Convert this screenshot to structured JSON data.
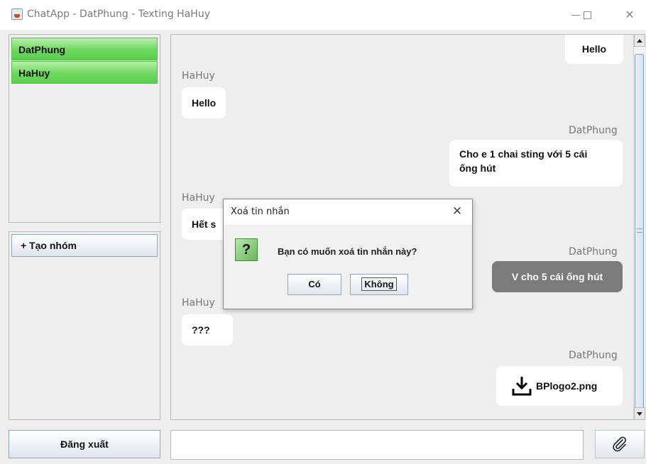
{
  "window": {
    "title": "ChatApp - DatPhung - Texting HaHuy",
    "minimize_icon": "minimize-icon",
    "maximize_icon": "maximize-icon",
    "close_icon": "close-icon"
  },
  "contacts": [
    {
      "name": "DatPhung"
    },
    {
      "name": "HaHuy"
    }
  ],
  "group": {
    "create_label": "+ Tạo nhóm"
  },
  "messages": [
    {
      "sender": "",
      "text": "Hello",
      "side": "right"
    },
    {
      "sender": "HaHuy",
      "text": "Hello",
      "side": "left"
    },
    {
      "sender": "DatPhung",
      "text_line1": "Cho e 1 chai sting với 5 cái",
      "text_line2": "ống hút",
      "side": "right"
    },
    {
      "sender": "HaHuy",
      "text": "Hết s",
      "side": "left"
    },
    {
      "sender": "DatPhung",
      "text": "V cho 5 cái ống hút",
      "side": "right",
      "selected": true
    },
    {
      "sender": "HaHuy",
      "text": "???",
      "side": "left"
    },
    {
      "sender": "DatPhung",
      "file": "BPlogo2.png",
      "icon": "download-icon",
      "side": "right"
    }
  ],
  "bottom": {
    "logout_label": "Đăng xuất",
    "message_value": "",
    "attach_icon": "paperclip-icon"
  },
  "dialog": {
    "title": "Xoá tin nhắn",
    "message": "Bạn có muốn xoá tin nhắn này?",
    "icon": "question-icon",
    "yes_label": "Có",
    "no_label": "Không"
  },
  "colors": {
    "contact_green": "#6ed860",
    "selected_bubble": "#7b7b7b",
    "background": "#eeeeee"
  }
}
